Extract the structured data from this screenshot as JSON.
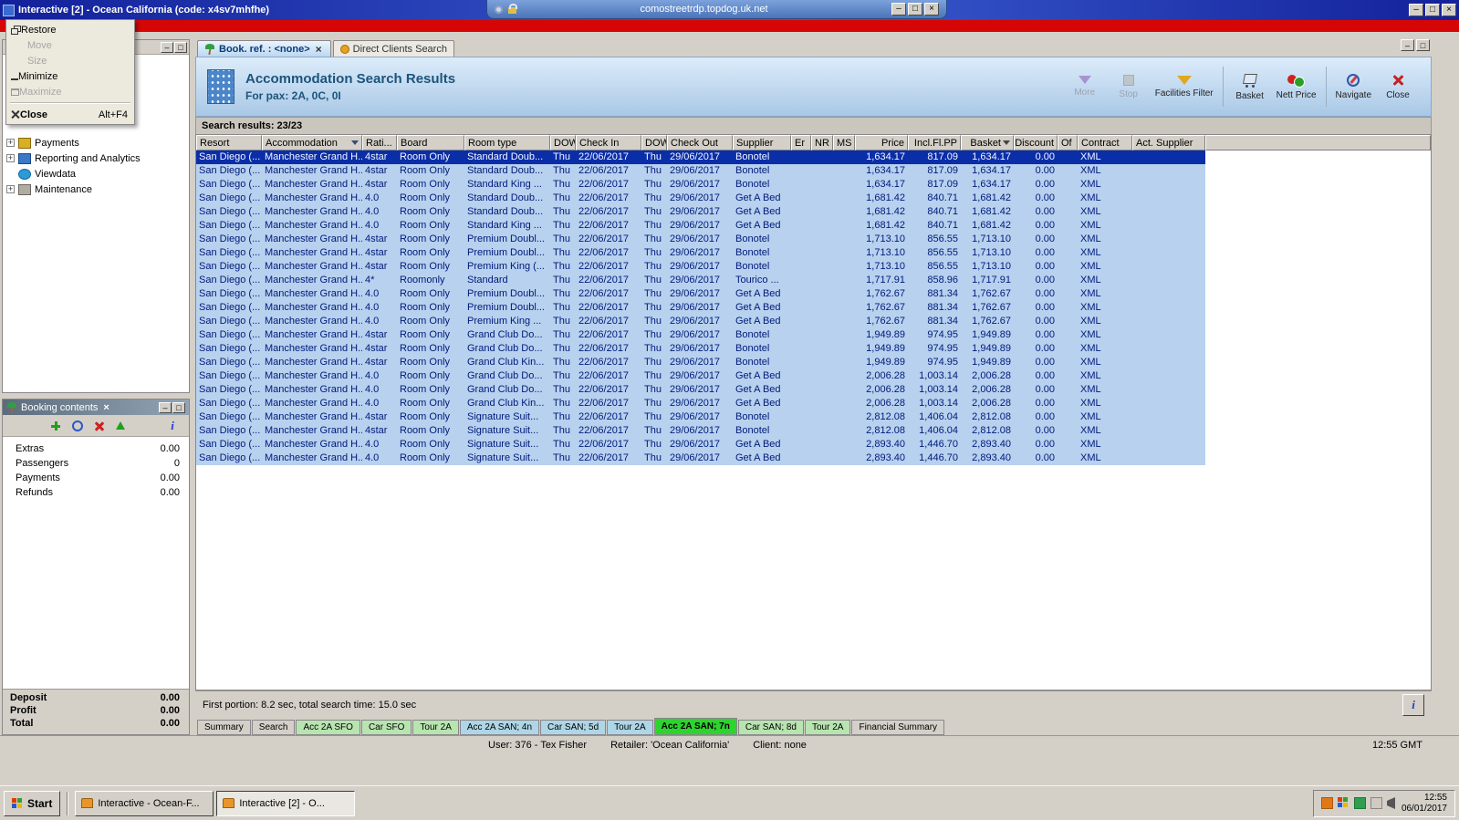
{
  "glyphs": {
    "minimize": "–",
    "restore": "□",
    "close": "×"
  },
  "window": {
    "title": "Interactive [2] - Ocean California (code: x4sv7mhfhe)",
    "rdp_address": "comostreetrdp.topdog.uk.net"
  },
  "system_menu": {
    "items": [
      {
        "label": "Restore",
        "icon": "restore-icon"
      },
      {
        "label": "Move",
        "disabled": true
      },
      {
        "label": "Size",
        "disabled": true
      },
      {
        "label": "Minimize",
        "icon": "minimize-icon"
      },
      {
        "label": "Maximize",
        "icon": "maximize-icon",
        "disabled": true
      },
      {
        "separator": true
      },
      {
        "label": "Close",
        "shortcut": "Alt+F4",
        "icon": "close-icon",
        "bold": true
      }
    ]
  },
  "sidebar": {
    "items": [
      {
        "label": "Payments",
        "expander": "+",
        "icon": "payments-icon"
      },
      {
        "label": "Reporting and Analytics",
        "expander": "+",
        "icon": "reporting-icon"
      },
      {
        "label": "Viewdata",
        "expander": "",
        "icon": "viewdata-icon"
      },
      {
        "label": "Maintenance",
        "expander": "+",
        "icon": "maintenance-icon"
      }
    ]
  },
  "booking_panel": {
    "title": "Booking contents",
    "toolbar": [
      {
        "icon": "add-icon"
      },
      {
        "icon": "refresh-icon"
      },
      {
        "icon": "delete-icon"
      },
      {
        "icon": "up-icon"
      },
      {
        "icon": "info-icon",
        "right": true
      }
    ],
    "rows": [
      {
        "label": "Extras",
        "value": "0.00"
      },
      {
        "label": "Passengers",
        "value": "0"
      },
      {
        "label": "Payments",
        "value": "0.00"
      },
      {
        "label": "Refunds",
        "value": "0.00"
      }
    ],
    "totals": [
      {
        "label": "Deposit",
        "value": "0.00"
      },
      {
        "label": "Profit",
        "value": "0.00"
      },
      {
        "label": "Total",
        "value": "0.00"
      }
    ]
  },
  "doc_tabs": [
    {
      "label": "Book. ref. : <none>",
      "active": true,
      "closable": true,
      "icon": "palm-icon"
    },
    {
      "label": "Direct Clients Search",
      "icon": "search-tab-icon"
    }
  ],
  "header": {
    "title": "Accommodation Search Results",
    "subtitle": "For pax: 2A, 0C, 0I",
    "tools": [
      {
        "label": "More",
        "icon": "more-icon",
        "disabled": true
      },
      {
        "label": "Stop",
        "icon": "stop-icon",
        "disabled": true
      },
      {
        "label": "Facilities Filter",
        "icon": "facilities-filter-icon"
      },
      {
        "separator": true
      },
      {
        "label": "Basket",
        "icon": "basket-icon"
      },
      {
        "label": "Nett Price",
        "icon": "nett-price-icon"
      },
      {
        "separator": true
      },
      {
        "label": "Navigate",
        "icon": "navigate-icon"
      },
      {
        "label": "Close",
        "icon": "close-red-icon"
      }
    ]
  },
  "results": {
    "summary": "Search results: 23/23",
    "portion": "First portion: 8.2 sec, total search time: 15.0 sec"
  },
  "table": {
    "columns": [
      "Resort",
      "Accommodation",
      "Rati...",
      "Board",
      "Room type",
      "DOW",
      "Check In",
      "DOW",
      "Check Out",
      "Supplier",
      "Er",
      "NR",
      "MS",
      "Price",
      "Incl.Fl.PP",
      "Basket",
      "Discount",
      "Of",
      "Contract",
      "Act. Supplier"
    ],
    "rows": [
      {
        "selected": true,
        "resort": "San Diego (...",
        "accommodation": "Manchester Grand H...",
        "rating": "4star",
        "board": "Room Only",
        "room_type": "Standard Doub...",
        "dow_in": "Thu",
        "check_in": "22/06/2017",
        "dow_out": "Thu",
        "check_out": "29/06/2017",
        "supplier": "Bonotel",
        "price": "1,634.17",
        "incl_fl_pp": "817.09",
        "basket": "1,634.17",
        "discount": "0.00",
        "contract": "XML"
      },
      {
        "resort": "San Diego (...",
        "accommodation": "Manchester Grand H...",
        "rating": "4star",
        "board": "Room Only",
        "room_type": "Standard Doub...",
        "dow_in": "Thu",
        "check_in": "22/06/2017",
        "dow_out": "Thu",
        "check_out": "29/06/2017",
        "supplier": "Bonotel",
        "price": "1,634.17",
        "incl_fl_pp": "817.09",
        "basket": "1,634.17",
        "discount": "0.00",
        "contract": "XML"
      },
      {
        "resort": "San Diego (...",
        "accommodation": "Manchester Grand H...",
        "rating": "4star",
        "board": "Room Only",
        "room_type": "Standard King ...",
        "dow_in": "Thu",
        "check_in": "22/06/2017",
        "dow_out": "Thu",
        "check_out": "29/06/2017",
        "supplier": "Bonotel",
        "price": "1,634.17",
        "incl_fl_pp": "817.09",
        "basket": "1,634.17",
        "discount": "0.00",
        "contract": "XML"
      },
      {
        "resort": "San Diego (...",
        "accommodation": "Manchester Grand H...",
        "rating": "4.0",
        "board": "Room Only",
        "room_type": "Standard Doub...",
        "dow_in": "Thu",
        "check_in": "22/06/2017",
        "dow_out": "Thu",
        "check_out": "29/06/2017",
        "supplier": "Get A Bed",
        "price": "1,681.42",
        "incl_fl_pp": "840.71",
        "basket": "1,681.42",
        "discount": "0.00",
        "contract": "XML"
      },
      {
        "resort": "San Diego (...",
        "accommodation": "Manchester Grand H...",
        "rating": "4.0",
        "board": "Room Only",
        "room_type": "Standard Doub...",
        "dow_in": "Thu",
        "check_in": "22/06/2017",
        "dow_out": "Thu",
        "check_out": "29/06/2017",
        "supplier": "Get A Bed",
        "price": "1,681.42",
        "incl_fl_pp": "840.71",
        "basket": "1,681.42",
        "discount": "0.00",
        "contract": "XML"
      },
      {
        "resort": "San Diego (...",
        "accommodation": "Manchester Grand H...",
        "rating": "4.0",
        "board": "Room Only",
        "room_type": "Standard King ...",
        "dow_in": "Thu",
        "check_in": "22/06/2017",
        "dow_out": "Thu",
        "check_out": "29/06/2017",
        "supplier": "Get A Bed",
        "price": "1,681.42",
        "incl_fl_pp": "840.71",
        "basket": "1,681.42",
        "discount": "0.00",
        "contract": "XML"
      },
      {
        "resort": "San Diego (...",
        "accommodation": "Manchester Grand H...",
        "rating": "4star",
        "board": "Room Only",
        "room_type": "Premium Doubl...",
        "dow_in": "Thu",
        "check_in": "22/06/2017",
        "dow_out": "Thu",
        "check_out": "29/06/2017",
        "supplier": "Bonotel",
        "price": "1,713.10",
        "incl_fl_pp": "856.55",
        "basket": "1,713.10",
        "discount": "0.00",
        "contract": "XML"
      },
      {
        "resort": "San Diego (...",
        "accommodation": "Manchester Grand H...",
        "rating": "4star",
        "board": "Room Only",
        "room_type": "Premium Doubl...",
        "dow_in": "Thu",
        "check_in": "22/06/2017",
        "dow_out": "Thu",
        "check_out": "29/06/2017",
        "supplier": "Bonotel",
        "price": "1,713.10",
        "incl_fl_pp": "856.55",
        "basket": "1,713.10",
        "discount": "0.00",
        "contract": "XML"
      },
      {
        "resort": "San Diego (...",
        "accommodation": "Manchester Grand H...",
        "rating": "4star",
        "board": "Room Only",
        "room_type": "Premium King (...",
        "dow_in": "Thu",
        "check_in": "22/06/2017",
        "dow_out": "Thu",
        "check_out": "29/06/2017",
        "supplier": "Bonotel",
        "price": "1,713.10",
        "incl_fl_pp": "856.55",
        "basket": "1,713.10",
        "discount": "0.00",
        "contract": "XML"
      },
      {
        "resort": "San Diego (...",
        "accommodation": "Manchester Grand H...",
        "rating": "4*",
        "board": "Roomonly",
        "room_type": "Standard",
        "dow_in": "Thu",
        "check_in": "22/06/2017",
        "dow_out": "Thu",
        "check_out": "29/06/2017",
        "supplier": "Tourico ...",
        "price": "1,717.91",
        "incl_fl_pp": "858.96",
        "basket": "1,717.91",
        "discount": "0.00",
        "contract": "XML"
      },
      {
        "resort": "San Diego (...",
        "accommodation": "Manchester Grand H...",
        "rating": "4.0",
        "board": "Room Only",
        "room_type": "Premium Doubl...",
        "dow_in": "Thu",
        "check_in": "22/06/2017",
        "dow_out": "Thu",
        "check_out": "29/06/2017",
        "supplier": "Get A Bed",
        "price": "1,762.67",
        "incl_fl_pp": "881.34",
        "basket": "1,762.67",
        "discount": "0.00",
        "contract": "XML"
      },
      {
        "resort": "San Diego (...",
        "accommodation": "Manchester Grand H...",
        "rating": "4.0",
        "board": "Room Only",
        "room_type": "Premium Doubl...",
        "dow_in": "Thu",
        "check_in": "22/06/2017",
        "dow_out": "Thu",
        "check_out": "29/06/2017",
        "supplier": "Get A Bed",
        "price": "1,762.67",
        "incl_fl_pp": "881.34",
        "basket": "1,762.67",
        "discount": "0.00",
        "contract": "XML"
      },
      {
        "resort": "San Diego (...",
        "accommodation": "Manchester Grand H...",
        "rating": "4.0",
        "board": "Room Only",
        "room_type": "Premium King ...",
        "dow_in": "Thu",
        "check_in": "22/06/2017",
        "dow_out": "Thu",
        "check_out": "29/06/2017",
        "supplier": "Get A Bed",
        "price": "1,762.67",
        "incl_fl_pp": "881.34",
        "basket": "1,762.67",
        "discount": "0.00",
        "contract": "XML"
      },
      {
        "resort": "San Diego (...",
        "accommodation": "Manchester Grand H...",
        "rating": "4star",
        "board": "Room Only",
        "room_type": "Grand Club Do...",
        "dow_in": "Thu",
        "check_in": "22/06/2017",
        "dow_out": "Thu",
        "check_out": "29/06/2017",
        "supplier": "Bonotel",
        "price": "1,949.89",
        "incl_fl_pp": "974.95",
        "basket": "1,949.89",
        "discount": "0.00",
        "contract": "XML"
      },
      {
        "resort": "San Diego (...",
        "accommodation": "Manchester Grand H...",
        "rating": "4star",
        "board": "Room Only",
        "room_type": "Grand Club Do...",
        "dow_in": "Thu",
        "check_in": "22/06/2017",
        "dow_out": "Thu",
        "check_out": "29/06/2017",
        "supplier": "Bonotel",
        "price": "1,949.89",
        "incl_fl_pp": "974.95",
        "basket": "1,949.89",
        "discount": "0.00",
        "contract": "XML"
      },
      {
        "resort": "San Diego (...",
        "accommodation": "Manchester Grand H...",
        "rating": "4star",
        "board": "Room Only",
        "room_type": "Grand Club Kin...",
        "dow_in": "Thu",
        "check_in": "22/06/2017",
        "dow_out": "Thu",
        "check_out": "29/06/2017",
        "supplier": "Bonotel",
        "price": "1,949.89",
        "incl_fl_pp": "974.95",
        "basket": "1,949.89",
        "discount": "0.00",
        "contract": "XML"
      },
      {
        "resort": "San Diego (...",
        "accommodation": "Manchester Grand H...",
        "rating": "4.0",
        "board": "Room Only",
        "room_type": "Grand Club Do...",
        "dow_in": "Thu",
        "check_in": "22/06/2017",
        "dow_out": "Thu",
        "check_out": "29/06/2017",
        "supplier": "Get A Bed",
        "price": "2,006.28",
        "incl_fl_pp": "1,003.14",
        "basket": "2,006.28",
        "discount": "0.00",
        "contract": "XML"
      },
      {
        "resort": "San Diego (...",
        "accommodation": "Manchester Grand H...",
        "rating": "4.0",
        "board": "Room Only",
        "room_type": "Grand Club Do...",
        "dow_in": "Thu",
        "check_in": "22/06/2017",
        "dow_out": "Thu",
        "check_out": "29/06/2017",
        "supplier": "Get A Bed",
        "price": "2,006.28",
        "incl_fl_pp": "1,003.14",
        "basket": "2,006.28",
        "discount": "0.00",
        "contract": "XML"
      },
      {
        "resort": "San Diego (...",
        "accommodation": "Manchester Grand H...",
        "rating": "4.0",
        "board": "Room Only",
        "room_type": "Grand Club Kin...",
        "dow_in": "Thu",
        "check_in": "22/06/2017",
        "dow_out": "Thu",
        "check_out": "29/06/2017",
        "supplier": "Get A Bed",
        "price": "2,006.28",
        "incl_fl_pp": "1,003.14",
        "basket": "2,006.28",
        "discount": "0.00",
        "contract": "XML"
      },
      {
        "resort": "San Diego (...",
        "accommodation": "Manchester Grand H...",
        "rating": "4star",
        "board": "Room Only",
        "room_type": "Signature Suit...",
        "dow_in": "Thu",
        "check_in": "22/06/2017",
        "dow_out": "Thu",
        "check_out": "29/06/2017",
        "supplier": "Bonotel",
        "price": "2,812.08",
        "incl_fl_pp": "1,406.04",
        "basket": "2,812.08",
        "discount": "0.00",
        "contract": "XML"
      },
      {
        "resort": "San Diego (...",
        "accommodation": "Manchester Grand H...",
        "rating": "4star",
        "board": "Room Only",
        "room_type": "Signature Suit...",
        "dow_in": "Thu",
        "check_in": "22/06/2017",
        "dow_out": "Thu",
        "check_out": "29/06/2017",
        "supplier": "Bonotel",
        "price": "2,812.08",
        "incl_fl_pp": "1,406.04",
        "basket": "2,812.08",
        "discount": "0.00",
        "contract": "XML"
      },
      {
        "resort": "San Diego (...",
        "accommodation": "Manchester Grand H...",
        "rating": "4.0",
        "board": "Room Only",
        "room_type": "Signature Suit...",
        "dow_in": "Thu",
        "check_in": "22/06/2017",
        "dow_out": "Thu",
        "check_out": "29/06/2017",
        "supplier": "Get A Bed",
        "price": "2,893.40",
        "incl_fl_pp": "1,446.70",
        "basket": "2,893.40",
        "discount": "0.00",
        "contract": "XML"
      },
      {
        "resort": "San Diego (...",
        "accommodation": "Manchester Grand H...",
        "rating": "4.0",
        "board": "Room Only",
        "room_type": "Signature Suit...",
        "dow_in": "Thu",
        "check_in": "22/06/2017",
        "dow_out": "Thu",
        "check_out": "29/06/2017",
        "supplier": "Get A Bed",
        "price": "2,893.40",
        "incl_fl_pp": "1,446.70",
        "basket": "2,893.40",
        "discount": "0.00",
        "contract": "XML"
      }
    ]
  },
  "bottom_tabs": [
    {
      "label": "Summary"
    },
    {
      "label": "Search"
    },
    {
      "label": "Acc 2A SFO",
      "color": "#b8e4b0"
    },
    {
      "label": "Car SFO",
      "color": "#b8e4b0"
    },
    {
      "label": "Tour 2A",
      "color": "#b8e4b0"
    },
    {
      "label": "Acc 2A SAN; 4n",
      "color": "#aed6e6"
    },
    {
      "label": "Car SAN; 5d",
      "color": "#aed6e6"
    },
    {
      "label": "Tour 2A",
      "color": "#aed6e6"
    },
    {
      "label": "Acc 2A SAN; 7n",
      "color": "#2ed42e",
      "active": true
    },
    {
      "label": "Car SAN; 8d",
      "color": "#b8e4b0"
    },
    {
      "label": "Tour 2A",
      "color": "#b8e4b0"
    },
    {
      "label": "Financial Summary"
    }
  ],
  "status_bar": {
    "user": "User: 376 - Tex Fisher",
    "retailer": "Retailer: 'Ocean California'",
    "client": "Client: none",
    "time": "12:55 GMT"
  },
  "taskbar": {
    "start_label": "Start",
    "tasks": [
      {
        "label": "Interactive - Ocean-F..."
      },
      {
        "label": "Interactive [2] - O...",
        "active": true
      }
    ],
    "tray": [
      {
        "icon": "orange-app-icon"
      },
      {
        "icon": "win-flag-icon"
      },
      {
        "icon": "green-app-icon"
      },
      {
        "icon": "printer-icon"
      },
      {
        "icon": "volume-icon"
      }
    ],
    "clock": {
      "time": "12:55",
      "date": "06/01/2017"
    }
  }
}
